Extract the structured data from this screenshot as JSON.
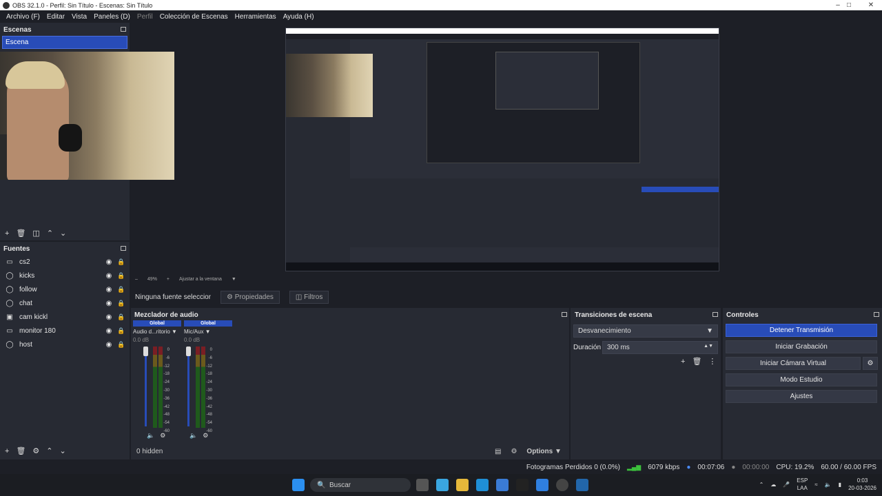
{
  "window": {
    "title": "OBS 32.1.0 - Perfil: Sin Título - Escenas: Sin Título"
  },
  "menu": [
    {
      "label": "Archivo (F)",
      "disabled": false
    },
    {
      "label": "Editar",
      "disabled": false
    },
    {
      "label": "Vista",
      "disabled": false
    },
    {
      "label": "Paneles (D)",
      "disabled": false
    },
    {
      "label": "Perfil",
      "disabled": true
    },
    {
      "label": "Colección de Escenas",
      "disabled": false
    },
    {
      "label": "Herramientas",
      "disabled": false
    },
    {
      "label": "Ayuda (H)",
      "disabled": false
    }
  ],
  "scenes": {
    "title": "Escenas",
    "items": [
      "Escena"
    ]
  },
  "sources": {
    "title": "Fuentes",
    "items": [
      {
        "name": "cs2",
        "icon": "monitor-icon"
      },
      {
        "name": "kicks",
        "icon": "browser-icon"
      },
      {
        "name": "follow",
        "icon": "browser-icon"
      },
      {
        "name": "chat",
        "icon": "browser-icon"
      },
      {
        "name": "cam kickl",
        "icon": "camera-icon"
      },
      {
        "name": "monitor 180",
        "icon": "monitor-icon"
      },
      {
        "name": "host",
        "icon": "browser-icon"
      }
    ]
  },
  "preview": {
    "zoom": "49%",
    "fit_label": "Ajustar a la ventana"
  },
  "properties_bar": {
    "no_source": "Ninguna fuente seleccionada",
    "properties": "Propiedades",
    "filters": "Filtros"
  },
  "mixer": {
    "title": "Mezclador de audio",
    "channels": [
      {
        "head": "Global",
        "name": "Audio d...ritorio",
        "db": "0.0 dB"
      },
      {
        "head": "Global",
        "name": "Mic/Aux",
        "db": "0.0 dB"
      }
    ],
    "scale": [
      "0",
      "-6",
      "-12",
      "-18",
      "-24",
      "-30",
      "-36",
      "-42",
      "-48",
      "-54",
      "-60"
    ],
    "hidden": "0 hidden",
    "options": "Options"
  },
  "transitions": {
    "title": "Transiciones de escena",
    "selected": "Desvanecimiento",
    "duration_label": "Duración",
    "duration": "300 ms"
  },
  "controls": {
    "title": "Controles",
    "buttons": [
      "Detener Transmisión",
      "Iniciar Grabación",
      "Iniciar Cámara Virtual",
      "Modo Estudio",
      "Ajustes"
    ]
  },
  "status": {
    "dropped": "Fotogramas Perdidos 0 (0.0%)",
    "bitrate": "6079 kbps",
    "stream_time": "00:07:06",
    "rec_time": "00:00:00",
    "cpu": "CPU: 19.2%",
    "fps": "60.00 / 60.00 FPS"
  },
  "taskbar": {
    "search": "Buscar",
    "lang_top": "ESP",
    "lang_bottom": "LAA",
    "time": "0:03",
    "date": "20-03-2026"
  },
  "colors": {
    "accent": "#284cb8",
    "panel": "#272a33",
    "background": "#1d1f26"
  }
}
